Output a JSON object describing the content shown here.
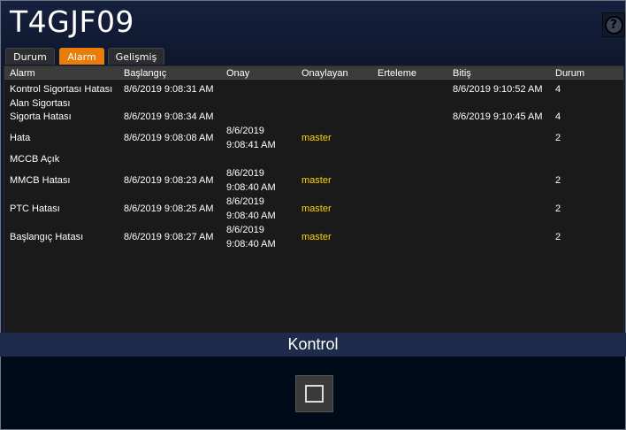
{
  "window": {
    "title": "T4GJF09",
    "help_glyph": "?"
  },
  "tabs": [
    {
      "label": "Durum",
      "active": false
    },
    {
      "label": "Alarm",
      "active": true
    },
    {
      "label": "Gelişmiş",
      "active": false
    }
  ],
  "table": {
    "columns": [
      "Alarm",
      "Başlangıç",
      "Onay",
      "Onaylayan",
      "Erteleme",
      "Bitiş",
      "Durum"
    ],
    "rows": [
      {
        "alarm": "Kontrol Sigortası Hatası",
        "start": "8/6/2019 9:08:31 AM",
        "ack_date": "",
        "ack_time": "",
        "acked_by": "",
        "snooze": "",
        "end": "8/6/2019 9:10:52 AM",
        "status": "4"
      },
      {
        "alarm": "Alan Sigortası",
        "start": "",
        "ack_date": "",
        "ack_time": "",
        "acked_by": "",
        "snooze": "",
        "end": "",
        "status": ""
      },
      {
        "alarm": "Sigorta Hatası",
        "start": "8/6/2019 9:08:34 AM",
        "ack_date": "",
        "ack_time": "",
        "acked_by": "",
        "snooze": "",
        "end": "8/6/2019 9:10:45 AM",
        "status": "4"
      },
      {
        "alarm": "Hata",
        "start": "8/6/2019 9:08:08 AM",
        "ack_date": "8/6/2019",
        "ack_time": "9:08:41 AM",
        "acked_by": "master",
        "snooze": "",
        "end": "",
        "status": "2"
      },
      {
        "alarm": "MCCB Açık",
        "start": "",
        "ack_date": "",
        "ack_time": "",
        "acked_by": "",
        "snooze": "",
        "end": "",
        "status": ""
      },
      {
        "alarm": "MMCB Hatası",
        "start": "8/6/2019 9:08:23 AM",
        "ack_date": "8/6/2019",
        "ack_time": "9:08:40 AM",
        "acked_by": "master",
        "snooze": "",
        "end": "",
        "status": "2"
      },
      {
        "alarm": "PTC Hatası",
        "start": "8/6/2019 9:08:25 AM",
        "ack_date": "8/6/2019",
        "ack_time": "9:08:40 AM",
        "acked_by": "master",
        "snooze": "",
        "end": "",
        "status": "2"
      },
      {
        "alarm": "Başlangıç Hatası",
        "start": "8/6/2019 9:08:27 AM",
        "ack_date": "8/6/2019",
        "ack_time": "9:08:40 AM",
        "acked_by": "master",
        "snooze": "",
        "end": "",
        "status": "2"
      }
    ]
  },
  "control": {
    "title": "Kontrol",
    "checked": false
  },
  "colors": {
    "accent_tab": "#e97d0a",
    "acked_by_text": "#ffd400"
  }
}
